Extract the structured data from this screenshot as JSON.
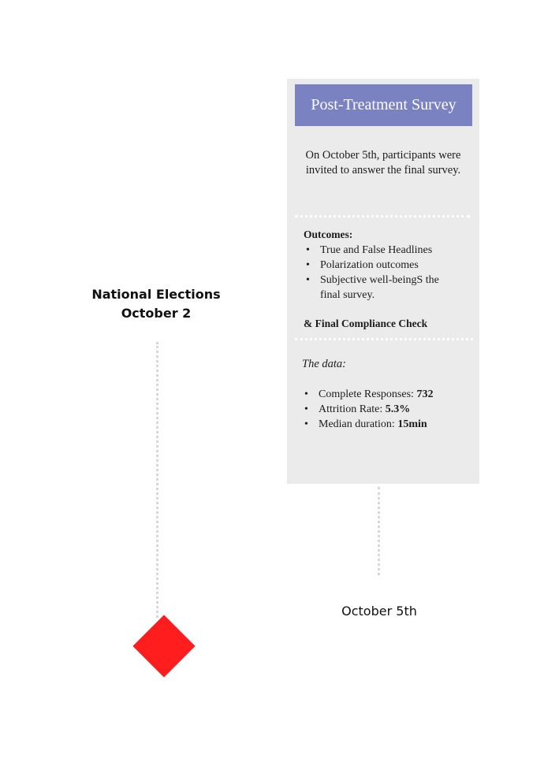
{
  "left_event": {
    "line1": "National Elections",
    "line2": "October 2"
  },
  "card": {
    "title": "Post-Treatment Survey",
    "intro": "On October 5th, participants were invited to answer the final survey.",
    "outcomes_title": "Outcomes:",
    "outcomes": [
      "True and False Headlines",
      "Polarization outcomes",
      "Subjective well-beingS the final survey."
    ],
    "compliance_title": "& Final Compliance Check",
    "data_intro": "The data:",
    "stats": [
      {
        "label": "Complete Responses: ",
        "value": "732"
      },
      {
        "label": "Attrition Rate: ",
        "value": "5.3%"
      },
      {
        "label": "Median duration: ",
        "value": "15min"
      }
    ],
    "header_color": "#7b82c2",
    "background_color": "#ebebeb"
  },
  "bottom_label": "October 5th",
  "marker_color": "#ff1d1d",
  "marker_icon": "diamond-marker-icon"
}
